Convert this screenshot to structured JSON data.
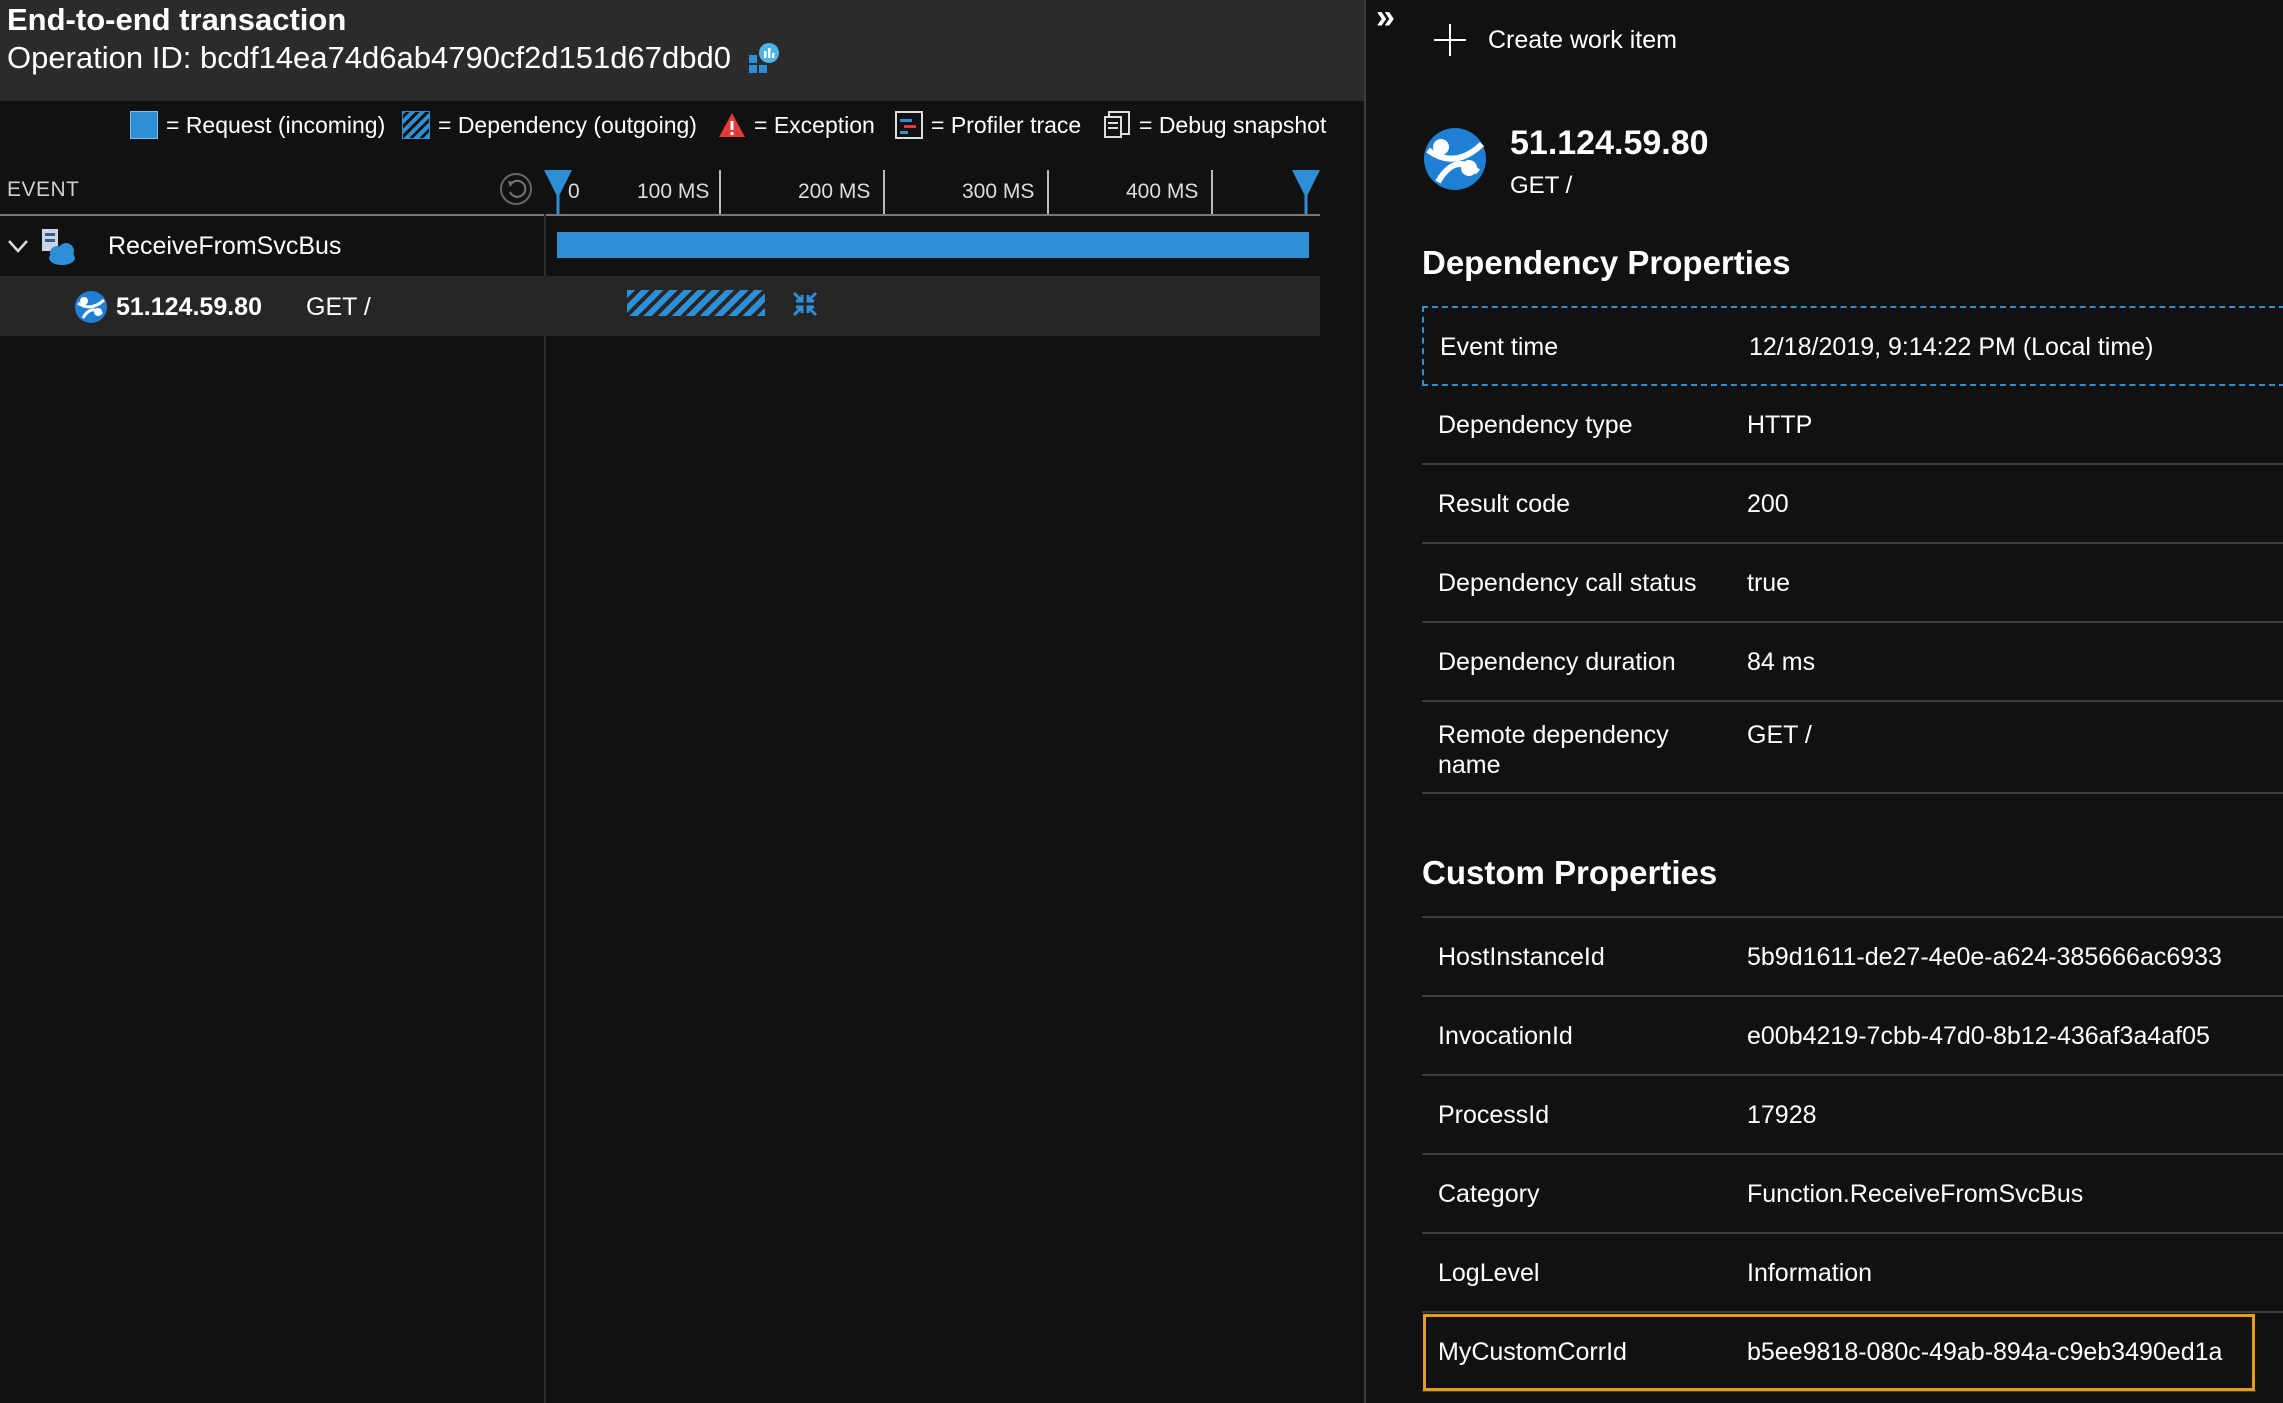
{
  "header": {
    "title": "End-to-end transaction",
    "operation_id": "Operation ID: bcdf14ea74d6ab4790cf2d151d67dbd0"
  },
  "legend": {
    "request": "= Request (incoming)",
    "dependency": "= Dependency (outgoing)",
    "exception": "= Exception",
    "profiler": "= Profiler trace",
    "snapshot": "= Debug snapshot"
  },
  "timeline": {
    "event_column": "EVENT",
    "ticks": [
      "0",
      "100 MS",
      "200 MS",
      "300 MS",
      "400 MS"
    ]
  },
  "events": [
    {
      "name": "ReceiveFromSvcBus",
      "icon": "function-app-icon"
    },
    {
      "ip": "51.124.59.80",
      "method": "GET /",
      "icon": "globe-icon"
    }
  ],
  "right": {
    "create_work_item": "Create work item",
    "resource_ip": "51.124.59.80",
    "resource_method": "GET /",
    "dependency_title": "Dependency Properties",
    "custom_title": "Custom Properties"
  },
  "dependency_properties": [
    {
      "key": "Event time",
      "value": "12/18/2019, 9:14:22 PM (Local time)"
    },
    {
      "key": "Dependency type",
      "value": "HTTP"
    },
    {
      "key": "Result code",
      "value": "200"
    },
    {
      "key": "Dependency call status",
      "value": "true"
    },
    {
      "key": "Dependency duration",
      "value": "84 ms"
    },
    {
      "key": "Remote dependency name",
      "value": "GET /"
    }
  ],
  "custom_properties": [
    {
      "key": "HostInstanceId",
      "value": "5b9d1611-de27-4e0e-a624-385666ac6933"
    },
    {
      "key": "InvocationId",
      "value": "e00b4219-7cbb-47d0-8b12-436af3a4af05"
    },
    {
      "key": "ProcessId",
      "value": "17928"
    },
    {
      "key": "Category",
      "value": "Function.ReceiveFromSvcBus"
    },
    {
      "key": "LogLevel",
      "value": "Information"
    },
    {
      "key": "MyCustomCorrId",
      "value": "b5ee9818-080c-49ab-894a-c9eb3490ed1a"
    }
  ],
  "colors": {
    "accent": "#2f8fd6",
    "highlight": "#e69a1e",
    "exception": "#e03a3a"
  }
}
